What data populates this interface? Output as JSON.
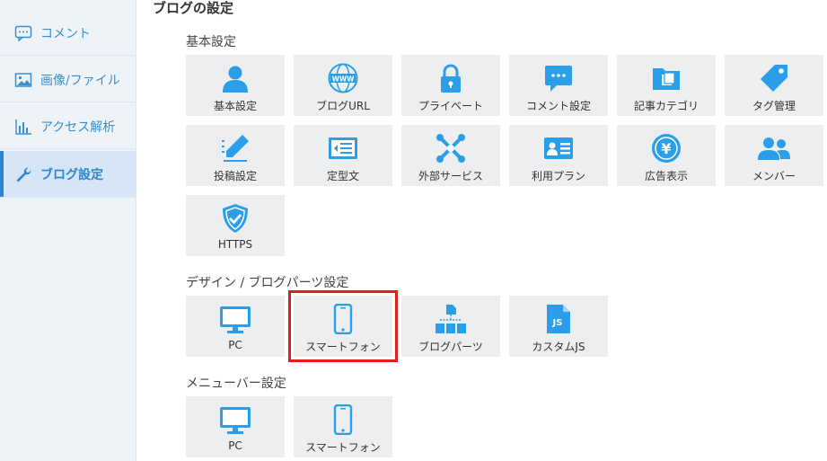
{
  "sidebar": {
    "items": [
      {
        "label": "コメント",
        "icon": "comment-icon"
      },
      {
        "label": "画像/ファイル",
        "icon": "image-icon"
      },
      {
        "label": "アクセス解析",
        "icon": "bar-chart-icon"
      },
      {
        "label": "ブログ設定",
        "icon": "wrench-icon"
      }
    ]
  },
  "page": {
    "title": "ブログの設定"
  },
  "sections": {
    "basic": {
      "title": "基本設定",
      "tiles": [
        {
          "label": "基本設定",
          "icon": "user-icon"
        },
        {
          "label": "ブログURL",
          "icon": "www-globe-icon"
        },
        {
          "label": "プライベート",
          "icon": "lock-icon"
        },
        {
          "label": "コメント設定",
          "icon": "comment-bubble-icon"
        },
        {
          "label": "記事カテゴリ",
          "icon": "folder-icon"
        },
        {
          "label": "タグ管理",
          "icon": "tag-icon"
        },
        {
          "label": "投稿設定",
          "icon": "pencil-icon"
        },
        {
          "label": "定型文",
          "icon": "template-icon"
        },
        {
          "label": "外部サービス",
          "icon": "tools-icon"
        },
        {
          "label": "利用プラン",
          "icon": "id-card-icon"
        },
        {
          "label": "広告表示",
          "icon": "yen-coin-icon"
        },
        {
          "label": "メンバー",
          "icon": "members-icon"
        },
        {
          "label": "HTTPS",
          "icon": "shield-check-icon"
        }
      ]
    },
    "design": {
      "title": "デザイン / ブログパーツ設定",
      "tiles": [
        {
          "label": "PC",
          "icon": "monitor-icon"
        },
        {
          "label": "スマートフォン",
          "icon": "smartphone-icon"
        },
        {
          "label": "ブログパーツ",
          "icon": "blog-parts-icon"
        },
        {
          "label": "カスタムJS",
          "icon": "js-file-icon"
        }
      ]
    },
    "menubar": {
      "title": "メニューバー設定",
      "tiles": [
        {
          "label": "PC",
          "icon": "monitor-icon"
        },
        {
          "label": "スマートフォン",
          "icon": "smartphone-icon"
        }
      ]
    }
  },
  "colors": {
    "accent": "#2a9ee8",
    "highlight": "#e02020",
    "tile_bg": "#edeef0"
  }
}
